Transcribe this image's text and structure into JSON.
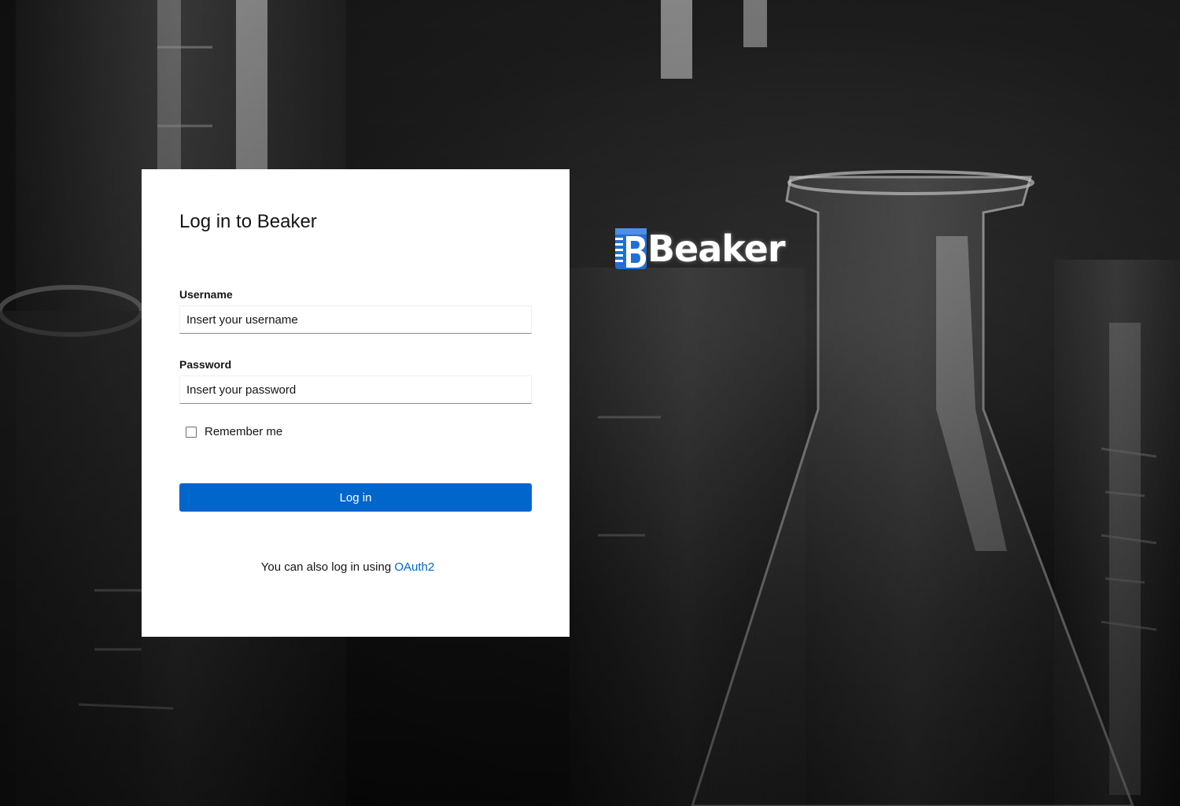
{
  "login": {
    "title": "Log in to Beaker",
    "username_label": "Username",
    "username_placeholder": "Insert your username",
    "password_label": "Password",
    "password_placeholder": "Insert your password",
    "remember_label": "Remember me",
    "remember_checked": false,
    "submit_label": "Log in",
    "alt_text": "You can also log in using",
    "alt_link": "OAuth2"
  },
  "brand": {
    "name": "Beaker",
    "accent_color": "#1f6fd6"
  },
  "colors": {
    "primary_button": "#0066cc",
    "link": "#0066cc",
    "card_bg": "#ffffff"
  }
}
